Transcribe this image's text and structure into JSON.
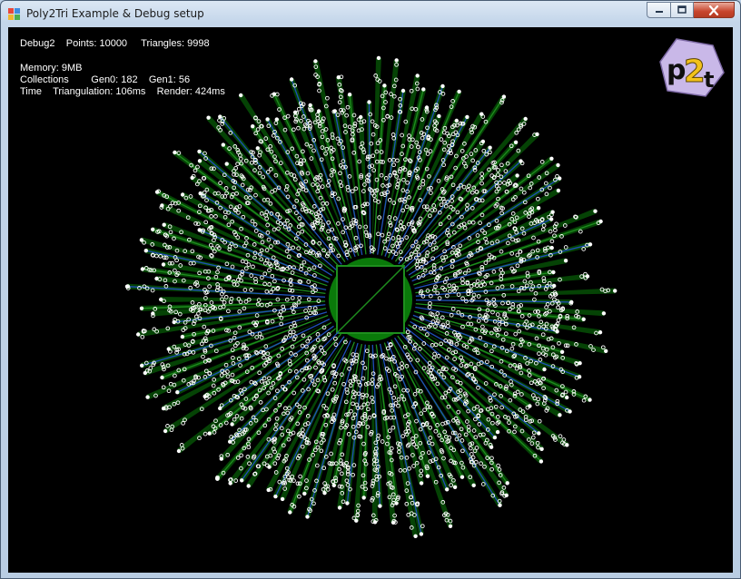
{
  "window": {
    "title": "Poly2Tri Example & Debug setup",
    "buttons": {
      "minimize": "minimize",
      "maximize": "maximize",
      "close": "close"
    }
  },
  "stats": {
    "mode": "Debug2",
    "points": "Points: 10000",
    "triangles": "Triangles: 9998",
    "memory": "Memory: 9MB",
    "collections_label": "Collections",
    "gen0": "Gen0: 182",
    "gen1": "Gen1: 56",
    "time_label": "Time",
    "triangulation": "Triangulation: 106ms",
    "render": "Render: 424ms"
  },
  "logo": {
    "text_p": "p",
    "text_2": "2",
    "text_t": "t"
  },
  "colors": {
    "background": "#000000",
    "points": "#ffffff",
    "triangle_fill": "#0a7a0a",
    "edge_blue": "#1f4fb8",
    "edge_green": "#1e8f1e"
  }
}
